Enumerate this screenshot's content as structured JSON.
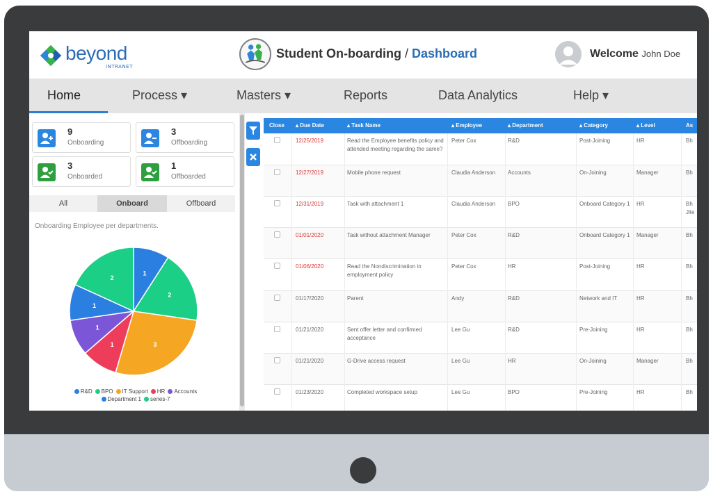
{
  "header": {
    "logo_text": "beyond",
    "logo_sub": "INTRANET",
    "app_title": "Student On-boarding",
    "separator": " / ",
    "breadcrumb_page": "Dashboard",
    "welcome": "Welcome",
    "user_name": "John Doe"
  },
  "nav": {
    "items": [
      {
        "label": "Home"
      },
      {
        "label": "Process ▾"
      },
      {
        "label": "Masters ▾"
      },
      {
        "label": "Reports"
      },
      {
        "label": "Data Analytics"
      },
      {
        "label": "Help ▾"
      }
    ]
  },
  "stats": [
    {
      "num": "9",
      "label": "Onboarding",
      "color": "#2a86e0"
    },
    {
      "num": "3",
      "label": "Offboarding",
      "color": "#2a86e0"
    },
    {
      "num": "3",
      "label": "Onboarded",
      "color": "#2e9e3e"
    },
    {
      "num": "1",
      "label": "Offboarded",
      "color": "#2e9e3e"
    }
  ],
  "tabs": [
    "All",
    "Onboard",
    "Offboard"
  ],
  "chart_caption": "Onboarding Employee per departments.",
  "chart_data": {
    "type": "pie",
    "categories": [
      "R&D",
      "BPO",
      "IT Support",
      "HR",
      "Accounts",
      "Department 1",
      "series-7"
    ],
    "slices": [
      {
        "label": "1",
        "value": 1,
        "color": "#2a7fe0"
      },
      {
        "label": "2",
        "value": 2,
        "color": "#1ccf86"
      },
      {
        "label": "3",
        "value": 3,
        "color": "#f5a623"
      },
      {
        "label": "1",
        "value": 1,
        "color": "#ee3d5b"
      },
      {
        "label": "1",
        "value": 1,
        "color": "#7b56d6"
      },
      {
        "label": "1",
        "value": 1,
        "color": "#2a7fe0"
      },
      {
        "label": "2",
        "value": 2,
        "color": "#1ccf86"
      }
    ],
    "legend": [
      {
        "label": "R&D",
        "color": "#2a7fe0"
      },
      {
        "label": "BPO",
        "color": "#1ccf86"
      },
      {
        "label": "IT Support",
        "color": "#f5a623"
      },
      {
        "label": "HR",
        "color": "#ee3d5b"
      },
      {
        "label": "Accounts",
        "color": "#7b56d6"
      },
      {
        "label": "Department 1",
        "color": "#2a7fe0"
      },
      {
        "label": "series-7",
        "color": "#1ccf86"
      }
    ]
  },
  "table": {
    "columns": [
      "Close",
      "▴ Due Date",
      "▴ Task Name",
      "▴ Employee",
      "▴ Department",
      "▴ Category",
      "▴ Level",
      "As"
    ],
    "rows": [
      {
        "due": "12/25/2019",
        "overdue": true,
        "task": "Read the Employee benefits policy and attended meeting regarding the same?",
        "employee": "Peter Cox",
        "department": "R&D",
        "category": "Post-Joining",
        "level": "HR",
        "extra": "Bh"
      },
      {
        "due": "12/27/2019",
        "overdue": true,
        "task": "Mobile phone request",
        "employee": "Claudia Anderson",
        "department": "Accounts",
        "category": "On-Joining",
        "level": "Manager",
        "extra": "Bh"
      },
      {
        "due": "12/31/2019",
        "overdue": true,
        "task": "Task with attachment 1",
        "employee": "Claudia Anderson",
        "department": "BPO",
        "category": "Onboard Category 1",
        "level": "HR",
        "extra": "Bh Jite"
      },
      {
        "due": "01/01/2020",
        "overdue": true,
        "task": "Task without attachment Manager",
        "employee": "Peter Cox",
        "department": "R&D",
        "category": "Onboard Category 1",
        "level": "Manager",
        "extra": "Bh"
      },
      {
        "due": "01/06/2020",
        "overdue": true,
        "task": "Read the Nondiscrimination in employment policy",
        "employee": "Peter Cox",
        "department": "HR",
        "category": "Post-Joining",
        "level": "HR",
        "extra": "Bh"
      },
      {
        "due": "01/17/2020",
        "overdue": false,
        "task": "Parent",
        "employee": "Andy",
        "department": "R&D",
        "category": "Network and IT",
        "level": "HR",
        "extra": "Bh"
      },
      {
        "due": "01/21/2020",
        "overdue": false,
        "task": "Sent offer letter and confirmed acceptance",
        "employee": "Lee Gu",
        "department": "R&D",
        "category": "Pre-Joining",
        "level": "HR",
        "extra": "Bh"
      },
      {
        "due": "01/21/2020",
        "overdue": false,
        "task": "G-Drive access request",
        "employee": "Lee Gu",
        "department": "HR",
        "category": "On-Joining",
        "level": "Manager",
        "extra": "Bh"
      },
      {
        "due": "01/23/2020",
        "overdue": false,
        "task": "Completed workspace setup",
        "employee": "Lee Gu",
        "department": "BPO",
        "category": "Pre-Joining",
        "level": "HR",
        "extra": "Bh"
      }
    ]
  }
}
